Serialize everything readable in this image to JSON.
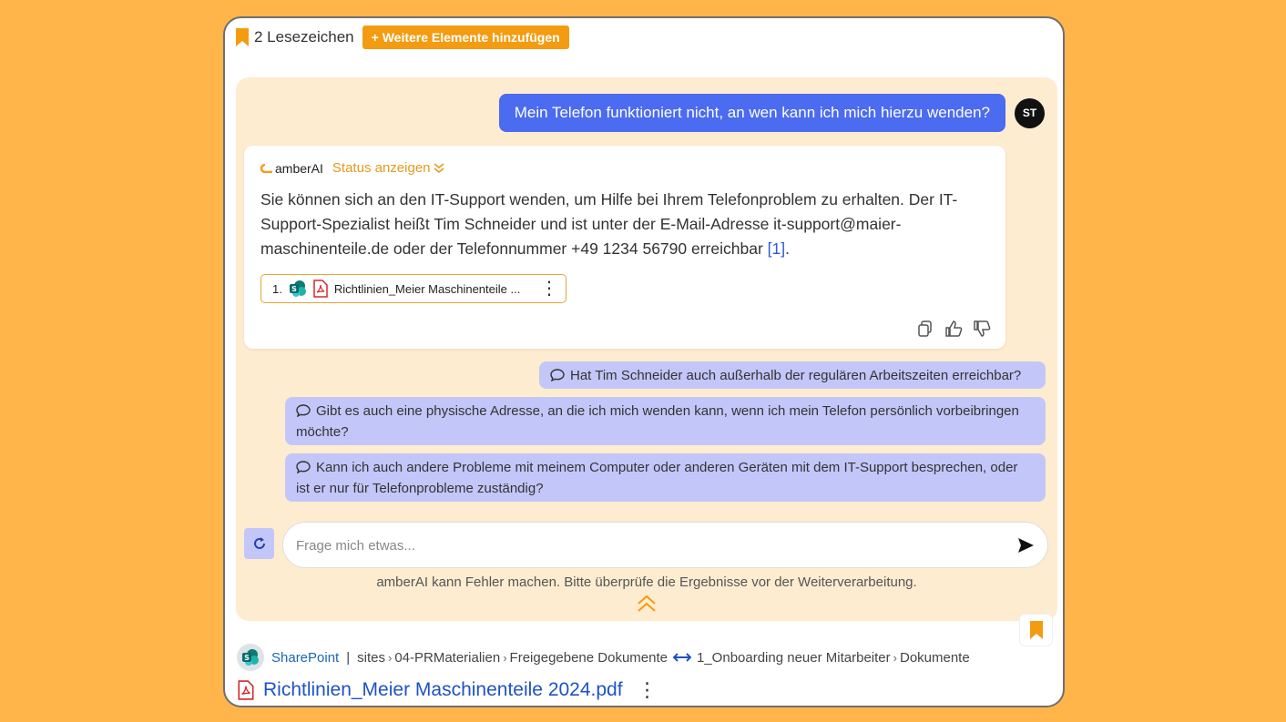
{
  "header": {
    "bookmark_count_label": "2 Lesezeichen",
    "add_button_label": "+ Weitere Elemente hinzufügen"
  },
  "conversation": {
    "user_message": "Mein Telefon funktioniert nicht, an wen kann ich mich hierzu wenden?",
    "user_initials": "ST",
    "assistant": {
      "brand": "amberAI",
      "status_label": "Status anzeigen",
      "answer_text": "Sie können sich an den IT-Support wenden, um Hilfe bei Ihrem Telefonproblem zu erhalten. Der IT-Support-Spezialist heißt Tim Schneider und ist unter der E-Mail-Adresse it-support@maier-maschinenteile.de oder der Telefonnummer +49 1234 56790 erreichbar ",
      "citation": "[1]",
      "answer_end": ".",
      "source": {
        "index": "1.",
        "name": "Richtlinien_Meier Maschinenteile ..."
      }
    },
    "suggestions": [
      "Hat Tim Schneider auch außerhalb der regulären Arbeitszeiten erreichbar?",
      "Gibt es auch eine physische Adresse, an die ich mich wenden kann, wenn ich mein Telefon persönlich vorbeibringen möchte?",
      "Kann ich auch andere Probleme mit meinem Computer oder anderen Geräten mit dem IT-Support besprechen, oder ist er nur für Telefonprobleme zuständig?"
    ]
  },
  "input": {
    "placeholder": "Frage mich etwas...",
    "value": ""
  },
  "disclaimer": "amberAI kann Fehler machen. Bitte überprüfe die Ergebnisse vor der Weiterverarbeitung.",
  "document": {
    "source_app": "SharePoint",
    "divider": "|",
    "path_start": "sites",
    "path_items": [
      "04-PRMaterialien",
      "Freigegebene Dokumente"
    ],
    "library": "1_Onboarding neuer Mitarbeiter",
    "library_child": "Dokumente",
    "title": "Richtlinien_Meier Maschinenteile 2024.pdf"
  },
  "colors": {
    "background": "#ffb54a",
    "chat_panel": "#feecd0",
    "user_bubble": "#4b6bf0",
    "suggestion": "#c3c6f8",
    "accent": "#f39c12",
    "link": "#1e52c8"
  },
  "icons": [
    "bookmark-icon",
    "chevron-double-down-icon",
    "sharepoint-icon",
    "pdf-icon",
    "kebab-menu-icon",
    "copy-icon",
    "thumbs-up-icon",
    "thumbs-down-icon",
    "chat-bubble-icon",
    "refresh-icon",
    "send-icon",
    "chevron-double-up-icon",
    "swap-arrows-icon"
  ]
}
